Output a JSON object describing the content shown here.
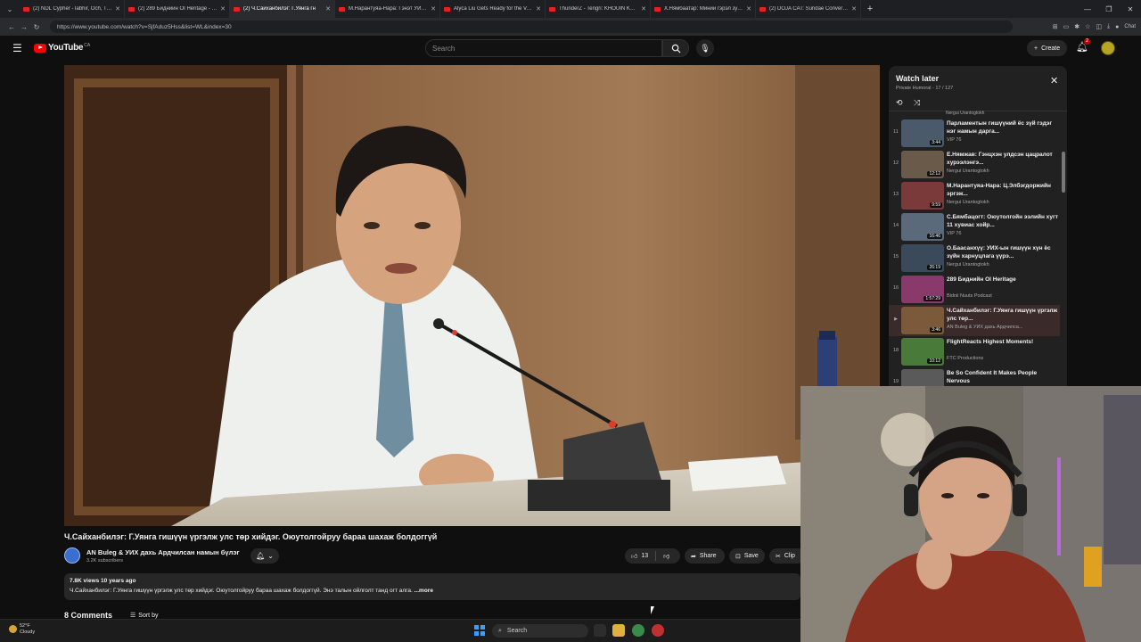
{
  "browser": {
    "tabs": [
      {
        "title": "(2) NDL Cypher -Tabhir, Och, Tutu"
      },
      {
        "title": "(2) 289 Биднийн OI Heritage - YouT"
      },
      {
        "title": "(2) Ч.Сайханбилэг: Г.Уянга гн"
      },
      {
        "title": "М.Нарантуяа-Нара: Гэнэт УИХ-ын"
      },
      {
        "title": "Alyca Liu Gets Ready for the Vanity"
      },
      {
        "title": "ThunderZ - Tengri: KHOUIN KHO!"
      },
      {
        "title": "Х.Нямбаатар: Миний гэрэл зургийг"
      },
      {
        "title": "(2) DOJA CAT: Sundae Conversatio"
      }
    ],
    "url": "https://www.youtube.com/watch?v=SjfAduz5Hss&list=WL&index=30"
  },
  "masthead": {
    "logo_text": "YouTube",
    "region": "CA",
    "search_placeholder": "Search",
    "create_label": "Create",
    "notification_count": "2"
  },
  "video": {
    "title": "Ч.Сайханбилэг: Г.Уянга гишүүн үргэлж улс төр хийдэг. Оюутолгойруу бараа шахаж болдоггүй",
    "channel": "AN Buleg & УИХ дахь Ардчилсан намын бүлэг",
    "subscribers": "3.2K subscribers",
    "likes": "13",
    "share_label": "Share",
    "save_label": "Save",
    "clip_label": "Clip",
    "views_date": "7.8K views  10 years ago",
    "description": "Ч.Сайханбилэг: Г.Уянга гишүүн үргэлж улс төр хийдэг. Оюутолгойруу бараа шахаж болдоггүй. Энэ талын ойлголт танд огт алга.",
    "more_label": "...more",
    "comments_heading": "8 Comments",
    "sort_label": "Sort by"
  },
  "playlist": {
    "title": "Watch later",
    "subtitle": "Private  Humoral - 17 / 127",
    "top_fragment": "Nergui Urantogtokh",
    "items": [
      {
        "index": "11",
        "title": "Парламентын гишүүний ёс зүй гэдэг нэг намын дарга...",
        "channel": "VIP 76",
        "duration": "3:44",
        "color": "#4a5a6a"
      },
      {
        "index": "12",
        "title": "Ё.Нямжав: Гэнцхэн улдсэн цацралот хурээлэнгэ...",
        "channel": "Nergui Urantogtokh",
        "duration": "12:12",
        "color": "#6a5a4a"
      },
      {
        "index": "13",
        "title": "М.Нарантуяа-Нара: Ц.Элбэгдоржийн эргэж...",
        "channel": "Nergui Urantogtokh",
        "duration": "9:59",
        "color": "#7a3a3a"
      },
      {
        "index": "14",
        "title": "С.Бямбацогт: Оюутолгойн ээлийн хугт 11 хувиас хойр...",
        "channel": "VIP 76",
        "duration": "16:46",
        "color": "#5a6a7a"
      },
      {
        "index": "15",
        "title": "О.Баасанхүү: УИХ-ын гишүүн хүн ёс зүйн харнуцлага үүрэ...",
        "channel": "Nergui Urantogtokh",
        "duration": "26:19",
        "color": "#3a4a5a"
      },
      {
        "index": "16",
        "title": "289 Биднийн OI Heritage",
        "channel": "Bidnii Nuuts Podcast",
        "duration": "1:57:29",
        "color": "#8a3a6a"
      },
      {
        "index": "",
        "title": "Ч.Сайханбилэг: Г.Уянга гишүүн үргэлж улс төр...",
        "channel": "AN Buleg & УИХ дахь Ардчилса...",
        "duration": "3:46",
        "color": "#7a5a3a"
      },
      {
        "index": "18",
        "title": "FlightReacts Highest Moments!",
        "channel": "FTC Productions",
        "duration": "10:12",
        "color": "#4a7a3a"
      },
      {
        "index": "19",
        "title": "Be So Confident It Makes People Nervous",
        "channel": "",
        "duration": "17:55",
        "color": "#5a5a5a"
      }
    ]
  },
  "taskbar": {
    "temperature": "52°F",
    "weather": "Cloudy",
    "search_label": "Search"
  }
}
